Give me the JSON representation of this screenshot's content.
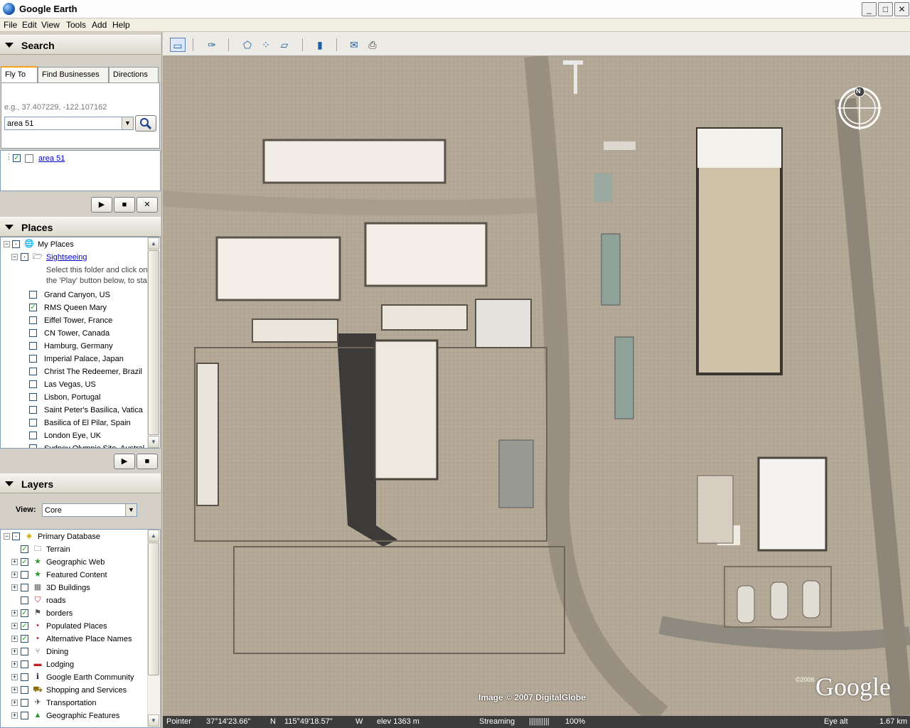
{
  "window": {
    "title": "Google Earth",
    "minimize": "_",
    "maximize": "□",
    "close": "✕"
  },
  "menu": [
    "File",
    "Edit",
    "View",
    "Tools",
    "Add",
    "Help"
  ],
  "search": {
    "header": "Search",
    "tabs": [
      "Fly To",
      "Find Businesses",
      "Directions"
    ],
    "hint": "e.g., 37.407229, -122.107162",
    "query": "area 51",
    "result": "area 51"
  },
  "places": {
    "header": "Places",
    "root": "My Places",
    "folder": "Sightseeing",
    "description_line1": "Select this folder and click on",
    "description_line2": "the 'Play' button below, to sta",
    "items": [
      {
        "label": "Grand Canyon, US",
        "checked": false
      },
      {
        "label": "RMS Queen Mary",
        "checked": true
      },
      {
        "label": "Eiffel Tower, France",
        "checked": false
      },
      {
        "label": "CN Tower, Canada",
        "checked": false
      },
      {
        "label": "Hamburg, Germany",
        "checked": false
      },
      {
        "label": "Imperial Palace, Japan",
        "checked": false
      },
      {
        "label": "Christ The Redeemer, Brazil",
        "checked": false
      },
      {
        "label": "Las Vegas, US",
        "checked": false
      },
      {
        "label": "Lisbon, Portugal",
        "checked": false
      },
      {
        "label": "Saint Peter's Basilica, Vatica",
        "checked": false
      },
      {
        "label": "Basilica of El Pilar, Spain",
        "checked": false
      },
      {
        "label": "London Eye, UK",
        "checked": false
      },
      {
        "label": "Sydney Olympic Site, Austral",
        "checked": false
      }
    ]
  },
  "layers": {
    "header": "Layers",
    "view_label": "View:",
    "view_value": "Core",
    "root": "Primary Database",
    "items": [
      {
        "label": "Terrain",
        "checked": true,
        "icon": "folder-icon",
        "expandable": false
      },
      {
        "label": "Geographic Web",
        "checked": true,
        "icon": "star-icon",
        "expandable": true
      },
      {
        "label": "Featured Content",
        "checked": false,
        "icon": "star-icon",
        "expandable": true
      },
      {
        "label": "3D Buildings",
        "checked": false,
        "icon": "building-icon",
        "expandable": true
      },
      {
        "label": "roads",
        "checked": false,
        "icon": "road-shield-icon",
        "expandable": false
      },
      {
        "label": "borders",
        "checked": true,
        "icon": "flag-icon",
        "expandable": true
      },
      {
        "label": "Populated Places",
        "checked": true,
        "icon": "dot-icon",
        "expandable": true
      },
      {
        "label": "Alternative Place Names",
        "checked": true,
        "icon": "dot-icon",
        "expandable": true
      },
      {
        "label": "Dining",
        "checked": false,
        "icon": "fork-knife-icon",
        "expandable": true
      },
      {
        "label": "Lodging",
        "checked": false,
        "icon": "bed-icon",
        "expandable": true
      },
      {
        "label": "Google Earth Community",
        "checked": false,
        "icon": "info-icon",
        "expandable": true
      },
      {
        "label": "Shopping and Services",
        "checked": false,
        "icon": "cart-icon",
        "expandable": true
      },
      {
        "label": "Transportation",
        "checked": false,
        "icon": "plane-icon",
        "expandable": true
      },
      {
        "label": "Geographic Features",
        "checked": false,
        "icon": "triangle-icon",
        "expandable": true
      }
    ]
  },
  "map": {
    "image_credit": "Image © 2007 DigitalGlobe",
    "copyright": "©2006",
    "brand": "Google",
    "compass_north": "N"
  },
  "status": {
    "pointer_label": "Pointer",
    "lat": "37°14'23.66\"",
    "lat_dir": "N",
    "lon": "115°49'18.57\"",
    "lon_dir": "W",
    "elev": "elev  1363 m",
    "streaming_label": "Streaming",
    "streaming_bar": "||||||||||",
    "streaming_pct": "100%",
    "eye_alt_label": "Eye  alt",
    "eye_alt": "1.67 km"
  }
}
